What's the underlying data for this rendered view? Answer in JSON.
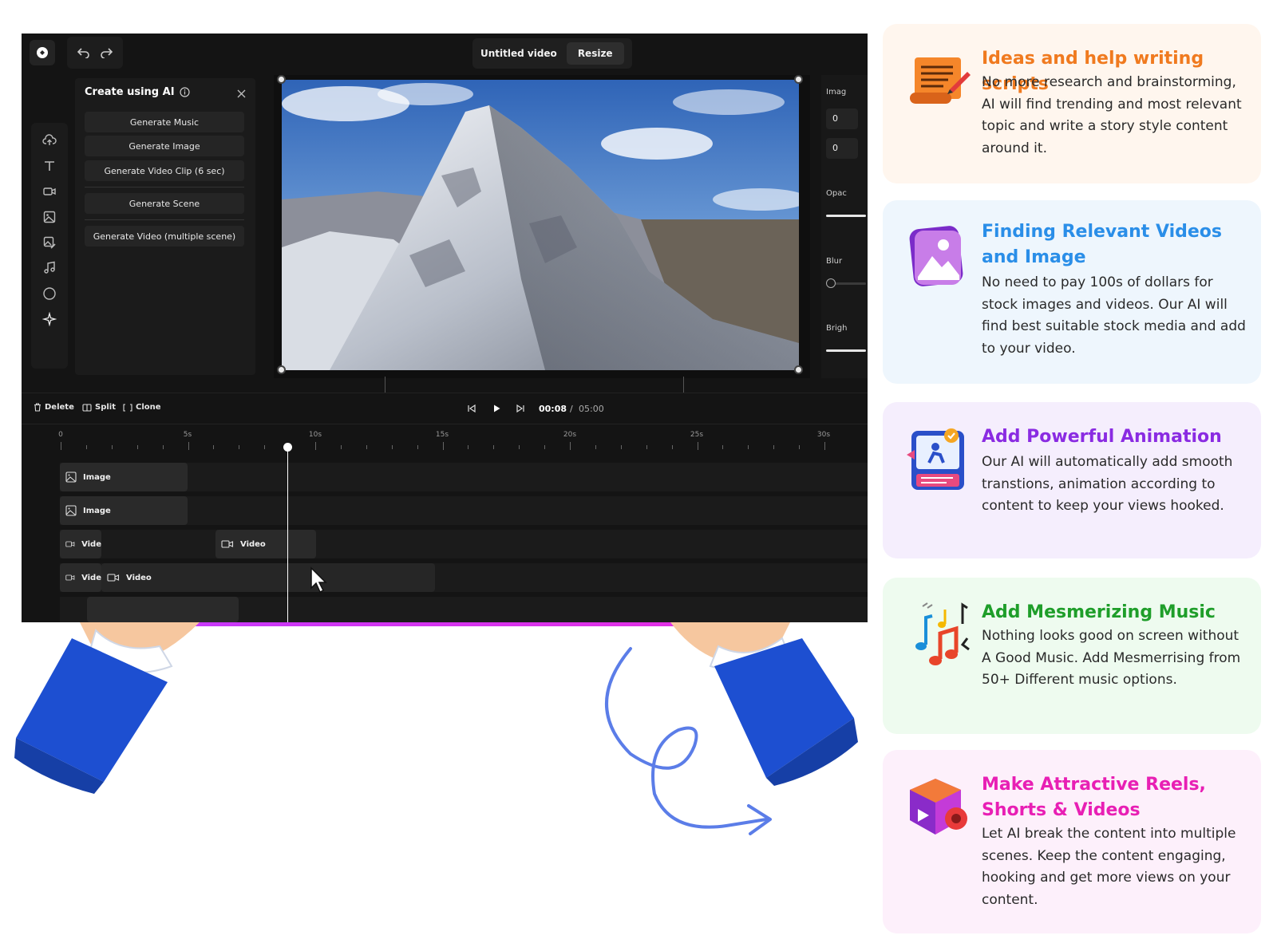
{
  "editor": {
    "title": "Untitled video",
    "resize_label": "Resize",
    "ai_panel": {
      "heading": "Create using AI",
      "buttons": [
        "Generate Music",
        "Generate Image",
        "Generate Video Clip (6 sec)",
        "Generate Scene",
        "Generate Video (multiple scene)"
      ]
    },
    "left_rail_icons": [
      "upload-icon",
      "text-icon",
      "video-icon",
      "image-icon",
      "image-edit-icon",
      "music-icon",
      "shape-icon",
      "ai-sparkle-icon"
    ],
    "properties": {
      "image_label": "Imag",
      "x_value": "0",
      "y_value": "0",
      "opacity_label": "Opac",
      "blur_label": "Blur",
      "brightness_label": "Brigh"
    },
    "controls": {
      "delete_label": "Delete",
      "split_label": "Split",
      "clone_label": "Clone",
      "current_time": "00:08",
      "time_separator": "/",
      "total_time": "05:00"
    },
    "ruler_labels": [
      "0",
      "5s",
      "10s",
      "15s",
      "20s",
      "25s",
      "30s"
    ],
    "tracks": {
      "track1_clip": "Image",
      "track2_clip": "Image",
      "track3_clip_a": "Vide",
      "track3_clip_b": "Video",
      "track4_clip_a": "Vide",
      "track4_clip_b": "Video"
    }
  },
  "features": [
    {
      "title": "Ideas and help writing scripts",
      "body": "No more research and brainstorming, AI will find trending and most relevant topic and write a story style content around it.",
      "color": "#f07a1f",
      "bg": "#fff6ee",
      "icon": "script-scroll-icon"
    },
    {
      "title": "Finding Relevant Videos and Image",
      "body": "No need to pay 100s of dollars for stock images and videos. Our AI will find best suitable stock media and add to your video.",
      "color": "#2a8ee8",
      "bg": "#eef6fd",
      "icon": "gallery-image-icon"
    },
    {
      "title": "Add Powerful Animation",
      "body": "Our AI will automatically add smooth transtions, animation according to content to keep your views hooked.",
      "color": "#8a2be2",
      "bg": "#f5eefd",
      "icon": "animation-board-icon"
    },
    {
      "title": "Add Mesmerizing Music",
      "body": "Nothing looks good on screen without A Good Music. Add Mesmerrising from 50+ Different music options.",
      "color": "#1f9e2a",
      "bg": "#eefbef",
      "icon": "music-notes-icon"
    },
    {
      "title": "Make Attractive Reels, Shorts & Videos",
      "body": "Let AI break the content into multiple scenes. Keep the content engaging, hooking and get more views on your content.",
      "color": "#e81fb4",
      "bg": "#fdf0fb",
      "icon": "video-cube-icon"
    }
  ]
}
